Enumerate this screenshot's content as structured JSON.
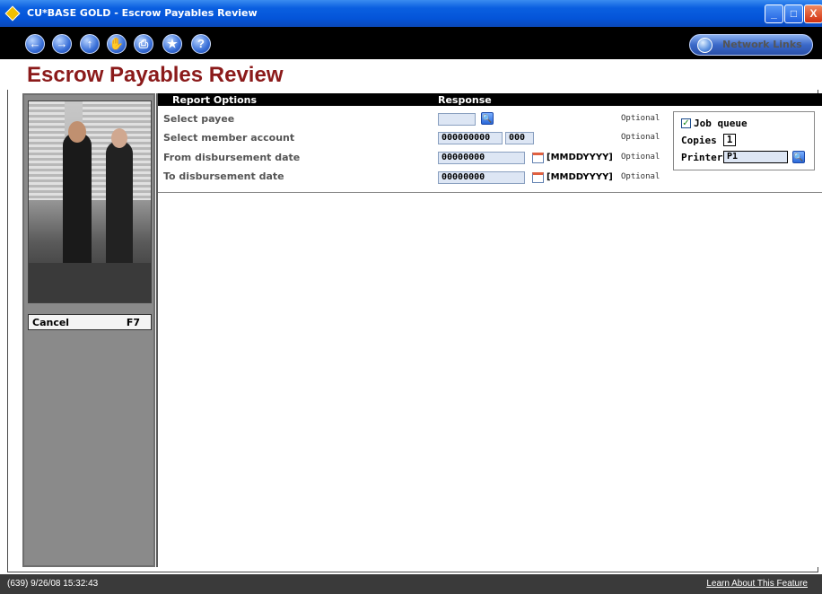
{
  "window": {
    "title": "CU*BASE GOLD - Escrow Payables Review",
    "controls": [
      "_",
      "□",
      "X"
    ]
  },
  "toolbar": {
    "nav_buttons": [
      "back",
      "forward",
      "up",
      "stop",
      "print",
      "favorite",
      "help"
    ],
    "nav_glyphs": [
      "←",
      "→",
      "↑",
      "✋",
      "⎙",
      "★",
      "?"
    ],
    "network_links_label": "Network Links"
  },
  "page": {
    "title": "Escrow Payables Review"
  },
  "sidebar": {
    "cancel_label": "Cancel",
    "cancel_key": "F7"
  },
  "form": {
    "header_options": "Report Options",
    "header_response": "Response",
    "rows": [
      {
        "label": "Select payee",
        "optional": "Optional"
      },
      {
        "label": "Select member account",
        "value1": "000000000",
        "value2": "000",
        "optional": "Optional"
      },
      {
        "label": "From disbursement date",
        "value": "00000000",
        "format": "[MMDDYYYY]",
        "optional": "Optional"
      },
      {
        "label": "To disbursement date",
        "value": "00000000",
        "format": "[MMDDYYYY]",
        "optional": "Optional"
      }
    ]
  },
  "job": {
    "job_queue_label": "Job queue",
    "job_queue_checked": true,
    "copies_label": "Copies",
    "copies_value": "1",
    "printer_label": "Printer",
    "printer_value": "P1"
  },
  "status": {
    "timestamp": "(639) 9/26/08 15:32:43",
    "learn_link": "Learn About This Feature"
  }
}
